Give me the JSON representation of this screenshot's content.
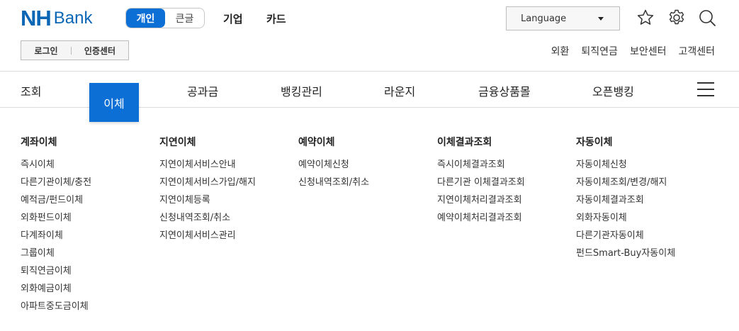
{
  "logo": {
    "nh": "NH",
    "bank": "Bank"
  },
  "mode_toggle": {
    "personal": "개인",
    "large": "큰글"
  },
  "top_links": {
    "corporate": "기업",
    "card": "카드"
  },
  "language": {
    "label": "Language"
  },
  "icons": [
    "star-icon",
    "gear-icon",
    "search-icon"
  ],
  "login_box": {
    "login": "로그인",
    "cert": "인증센터"
  },
  "util_links": [
    "외환",
    "퇴직연금",
    "보안센터",
    "고객센터"
  ],
  "gnb": {
    "items": [
      "조회",
      "이체",
      "공과금",
      "뱅킹관리",
      "라운지",
      "금융상품몰",
      "오픈뱅킹"
    ],
    "active": "이체"
  },
  "menu": [
    {
      "title": "계좌이체",
      "items": [
        "즉시이체",
        "다른기관이체/충전",
        "예적금/펀드이체",
        "외화펀드이체",
        "다계좌이체",
        "그룹이체",
        "퇴직연금이체",
        "외화예금이체",
        "아파트중도금이체"
      ]
    },
    {
      "title": "지연이체",
      "items": [
        "지연이체서비스안내",
        "지연이체서비스가입/해지",
        "지연이체등록",
        "신청내역조회/취소",
        "지연이체서비스관리"
      ]
    },
    {
      "title": "예약이체",
      "items": [
        "예약이체신청",
        "신청내역조회/취소"
      ]
    },
    {
      "title": "이체결과조회",
      "items": [
        "즉시이체결과조회",
        "다른기관 이체결과조회",
        "지연이체처리결과조회",
        "예약이체처리결과조회"
      ]
    },
    {
      "title": "자동이체",
      "items": [
        "자동이체신청",
        "자동이체조회/변경/해지",
        "자동이체결과조회",
        "외화자동이체",
        "다른기관자동이체",
        "펀드Smart-Buy자동이체"
      ]
    }
  ],
  "colors": {
    "brand": "#0b67b5",
    "accent": "#0b6fd6"
  }
}
